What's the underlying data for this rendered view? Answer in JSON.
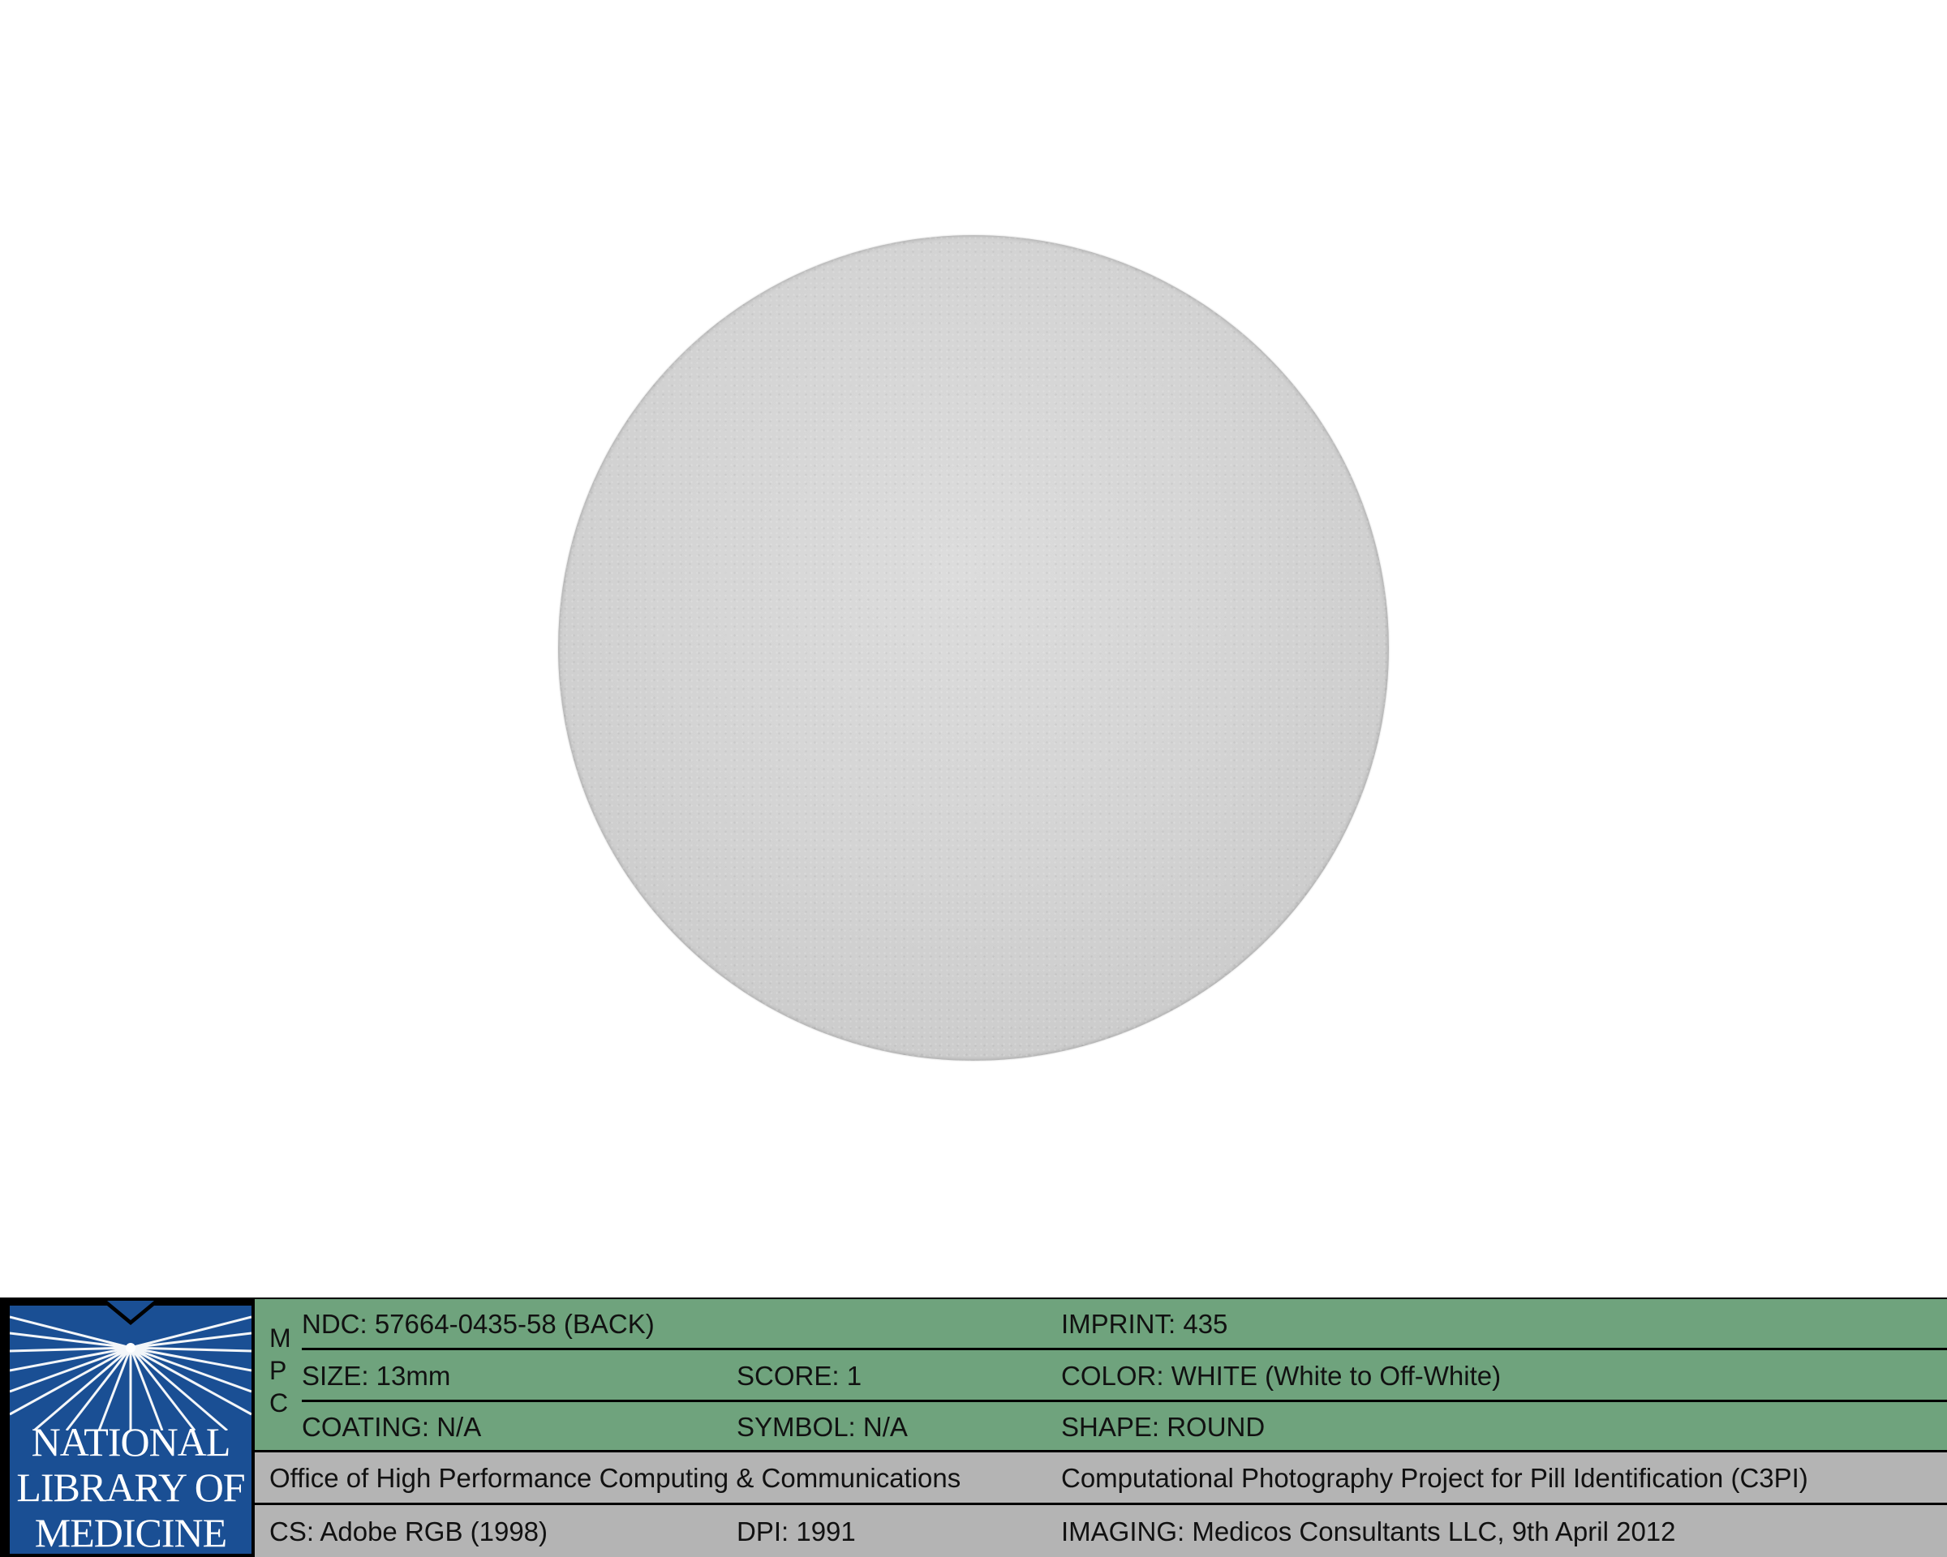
{
  "logo": {
    "line1": "NATIONAL",
    "line2": "LIBRARY OF",
    "line3": "MEDICINE"
  },
  "mpc": [
    "M",
    "P",
    "C"
  ],
  "rows": {
    "ndc": "NDC: 57664-0435-58 (BACK)",
    "imprint": "IMPRINT: 435",
    "size": "SIZE: 13mm",
    "score": "SCORE: 1",
    "color": "COLOR: WHITE (White to Off-White)",
    "coating": "COATING: N/A",
    "symbol": "SYMBOL: N/A",
    "shape": "SHAPE: ROUND",
    "office": "Office of High Performance Computing & Communications",
    "project": "Computational Photography Project for Pill Identification (C3PI)",
    "cs": "CS: Adobe RGB (1998)",
    "dpi": "DPI: 1991",
    "imaging": "IMAGING: Medicos Consultants LLC, 9th April 2012"
  },
  "colors": {
    "green_band": "#6fa37d",
    "gray_band": "#b4b4b4",
    "logo_blue": "#1a4f94",
    "pill": "#d4d4d4"
  }
}
